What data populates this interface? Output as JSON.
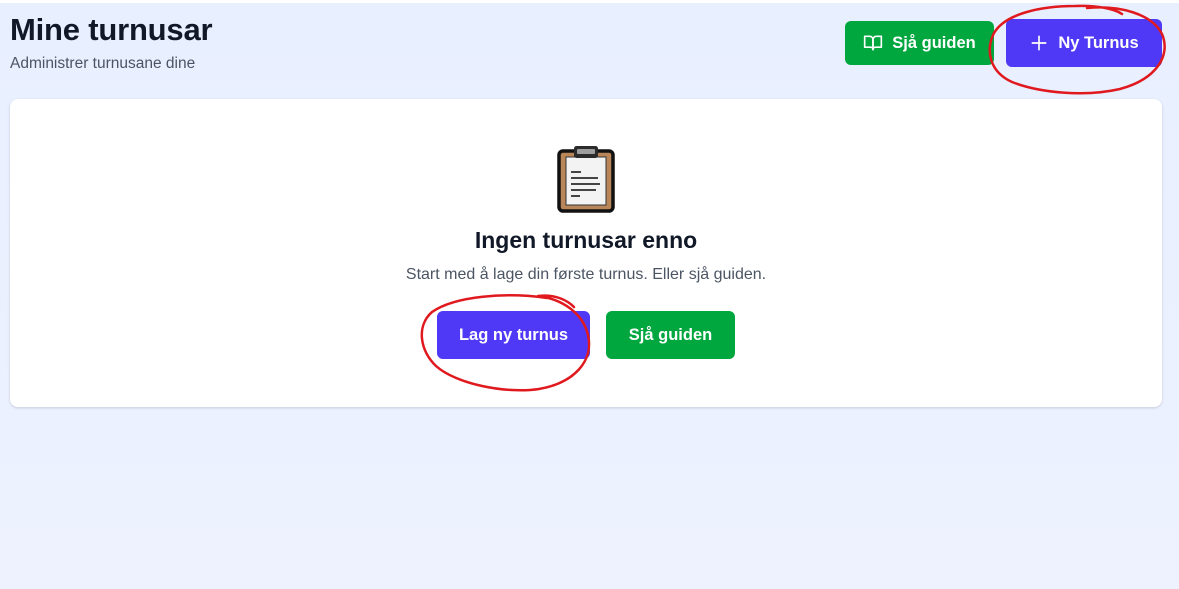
{
  "header": {
    "title": "Mine turnusar",
    "subtitle": "Administrer turnusane dine"
  },
  "toolbar": {
    "guide_label": "Sjå guiden",
    "guide_icon": "book-open-icon",
    "new_label": "Ny Turnus",
    "new_icon": "plus-icon"
  },
  "empty_state": {
    "icon": "clipboard-icon",
    "title": "Ingen turnusar enno",
    "text": "Start med å lage din første turnus. Eller sjå guiden.",
    "create_label": "Lag ny turnus",
    "guide_label": "Sjå guiden"
  },
  "colors": {
    "primary": "#4f39f6",
    "success": "#00a63e",
    "background": "#e8efff",
    "annotation": "#e0191e"
  }
}
